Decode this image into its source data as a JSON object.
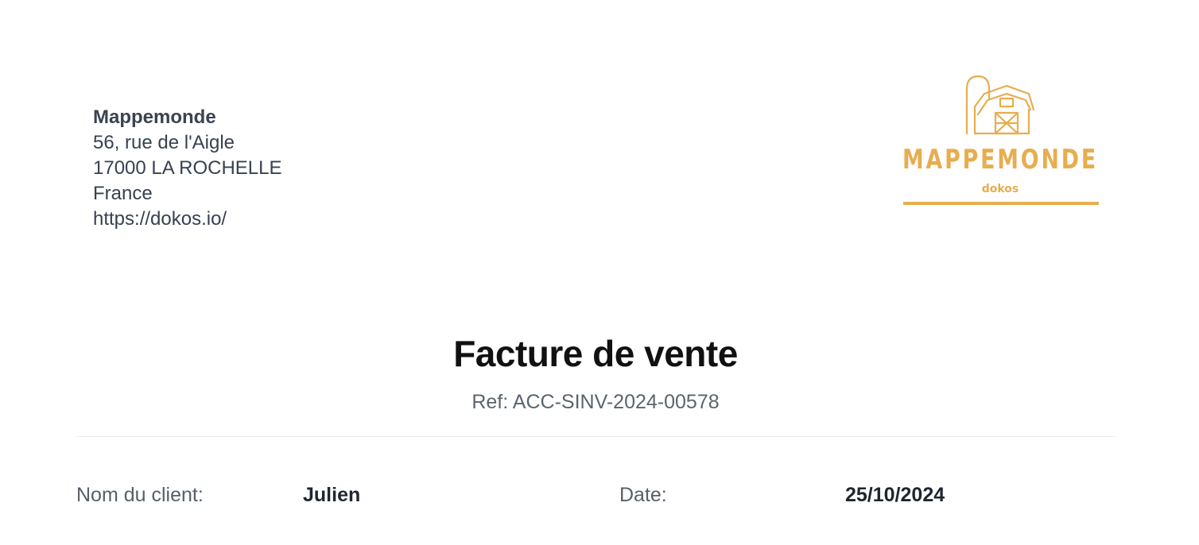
{
  "company": {
    "name": "Mappemonde",
    "address_line1": "56, rue de l'Aigle",
    "address_line2": "17000 LA ROCHELLE",
    "country": "France",
    "website": "https://dokos.io/"
  },
  "logo": {
    "brand": "MAPPEMONDE",
    "tagline": "dokos",
    "icon": "barn-silo-icon",
    "color": "#e8ad4f"
  },
  "document": {
    "title": "Facture de vente",
    "ref_prefix": "Ref:",
    "ref_value": "ACC-SINV-2024-00578"
  },
  "fields": {
    "customer_label": "Nom du client:",
    "customer_value": "Julien",
    "date_label": "Date:",
    "date_value": "25/10/2024"
  }
}
